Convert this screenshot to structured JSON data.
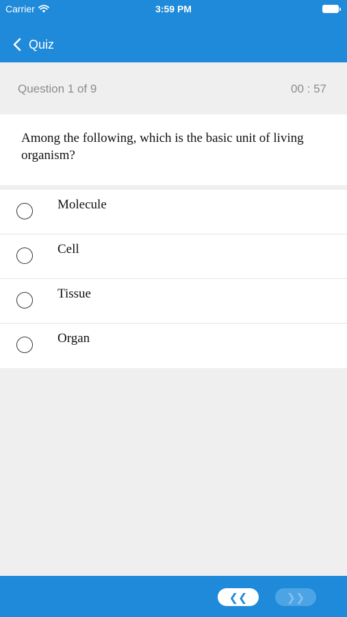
{
  "status_bar": {
    "carrier": "Carrier",
    "time": "3:59 PM",
    "icons": [
      "wifi-icon",
      "battery-icon"
    ]
  },
  "nav": {
    "back_icon": "back-chevron-icon",
    "title": "Quiz"
  },
  "quiz": {
    "counter": "Question 1 of 9",
    "timer": "00 : 57",
    "question": "Among the following, which is the basic unit of living organism?",
    "options": [
      {
        "label": "Molecule",
        "selected": false
      },
      {
        "label": "Cell",
        "selected": false
      },
      {
        "label": "Tissue",
        "selected": false
      },
      {
        "label": "Organ",
        "selected": false
      }
    ]
  },
  "footer": {
    "prev_label": "❮❮",
    "next_label": "❯❯",
    "next_enabled": false
  },
  "colors": {
    "primary": "#1f8ad9",
    "background": "#efefef",
    "card": "#ffffff",
    "muted_text": "#8c8c8c"
  }
}
